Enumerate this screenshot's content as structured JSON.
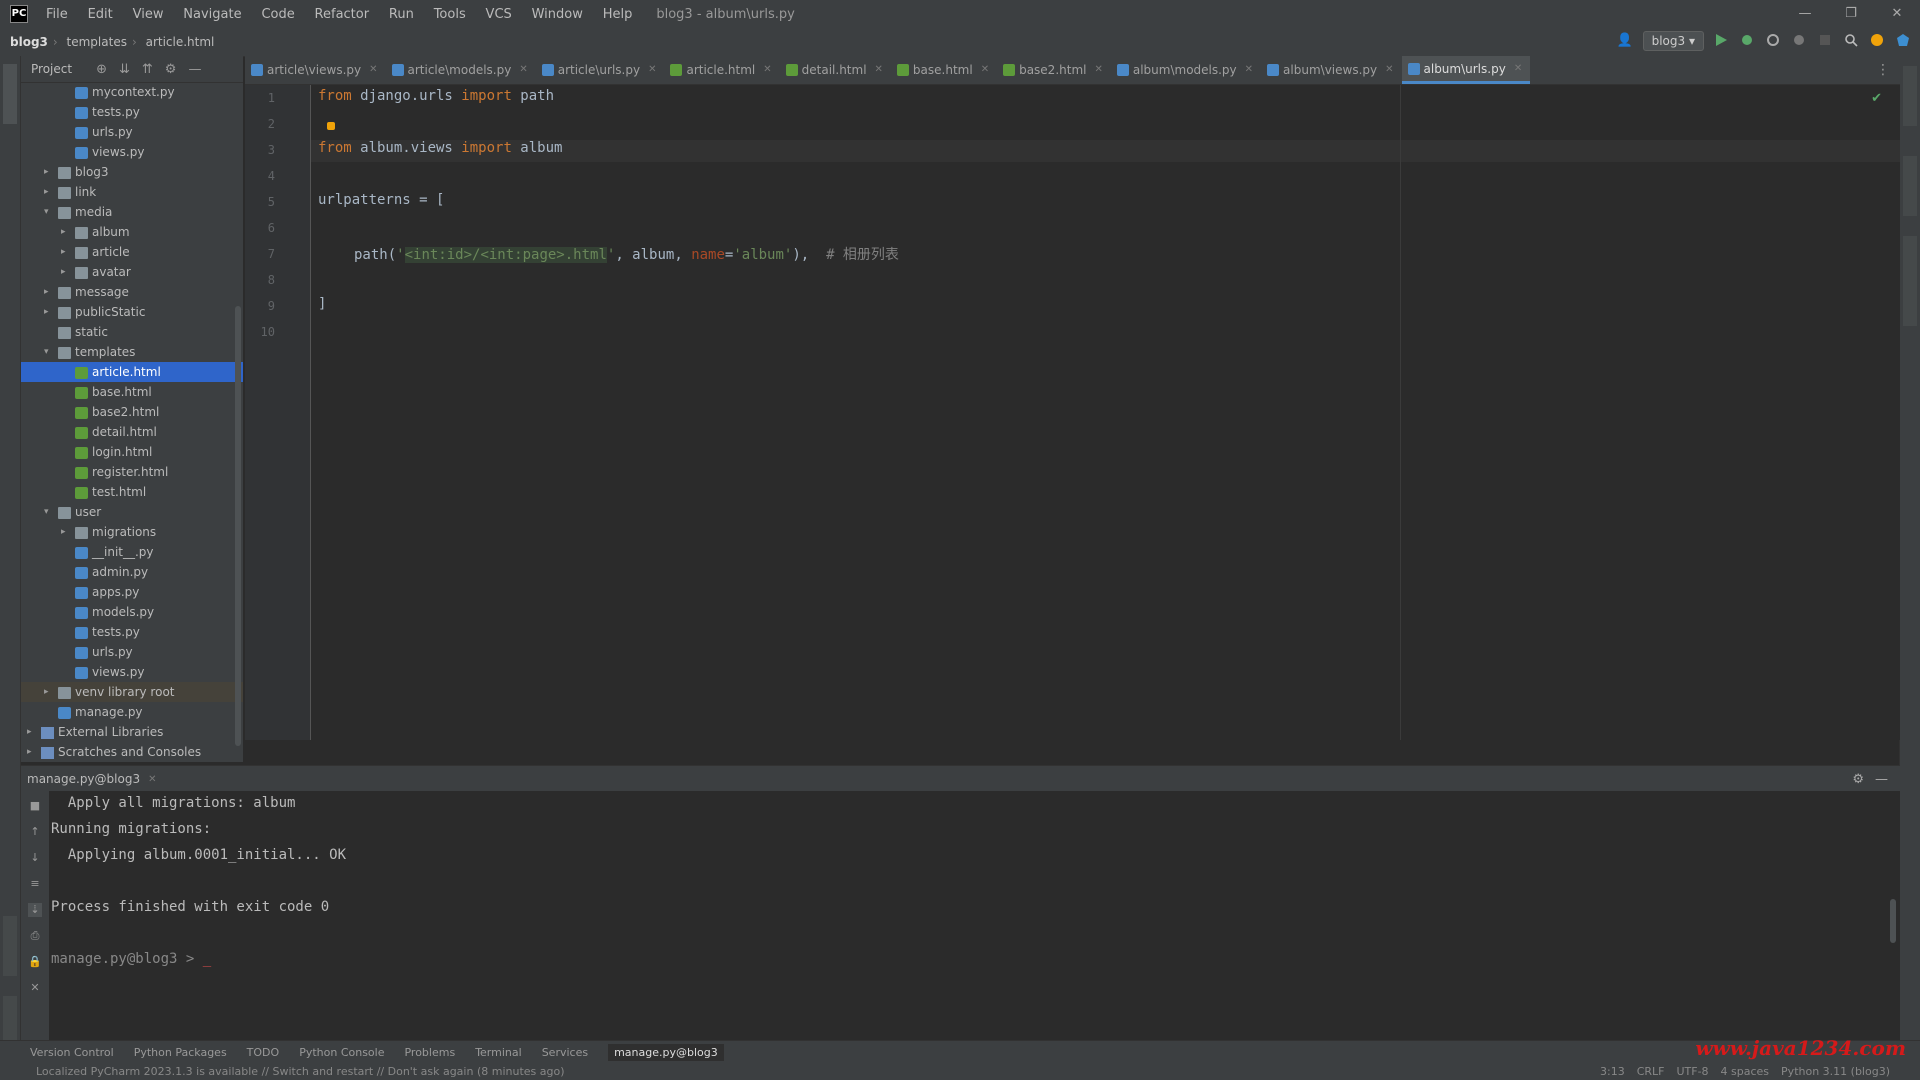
{
  "titlebar": {
    "menu": [
      "File",
      "Edit",
      "View",
      "Navigate",
      "Code",
      "Refactor",
      "Run",
      "Tools",
      "VCS",
      "Window",
      "Help"
    ],
    "title": "blog3 - album\\urls.py",
    "controls": [
      "—",
      "❐",
      "✕"
    ]
  },
  "navbar": {
    "breadcrumb": [
      "blog3",
      "templates",
      "article.html"
    ],
    "run_config": "blog3"
  },
  "project": {
    "title": "Project",
    "tree": [
      {
        "label": "mycontext.py",
        "kind": "py",
        "depth": 3
      },
      {
        "label": "tests.py",
        "kind": "py",
        "depth": 3
      },
      {
        "label": "urls.py",
        "kind": "py",
        "depth": 3
      },
      {
        "label": "views.py",
        "kind": "py",
        "depth": 3
      },
      {
        "label": "blog3",
        "kind": "folder",
        "depth": 2,
        "arrow": "›"
      },
      {
        "label": "link",
        "kind": "folder",
        "depth": 2,
        "arrow": "›"
      },
      {
        "label": "media",
        "kind": "folder",
        "depth": 2,
        "arrow": "⌄"
      },
      {
        "label": "album",
        "kind": "folder",
        "depth": 3,
        "arrow": "›"
      },
      {
        "label": "article",
        "kind": "folder",
        "depth": 3,
        "arrow": "›"
      },
      {
        "label": "avatar",
        "kind": "folder",
        "depth": 3,
        "arrow": "›"
      },
      {
        "label": "message",
        "kind": "folder",
        "depth": 2,
        "arrow": "›"
      },
      {
        "label": "publicStatic",
        "kind": "folder",
        "depth": 2,
        "arrow": "›"
      },
      {
        "label": "static",
        "kind": "folder",
        "depth": 2
      },
      {
        "label": "templates",
        "kind": "folder",
        "depth": 2,
        "arrow": "⌄"
      },
      {
        "label": "article.html",
        "kind": "html",
        "depth": 3,
        "selected": true
      },
      {
        "label": "base.html",
        "kind": "html",
        "depth": 3
      },
      {
        "label": "base2.html",
        "kind": "html",
        "depth": 3
      },
      {
        "label": "detail.html",
        "kind": "html",
        "depth": 3
      },
      {
        "label": "login.html",
        "kind": "html",
        "depth": 3
      },
      {
        "label": "register.html",
        "kind": "html",
        "depth": 3
      },
      {
        "label": "test.html",
        "kind": "html",
        "depth": 3
      },
      {
        "label": "user",
        "kind": "folder",
        "depth": 2,
        "arrow": "⌄"
      },
      {
        "label": "migrations",
        "kind": "folder",
        "depth": 3,
        "arrow": "›"
      },
      {
        "label": "__init__.py",
        "kind": "py",
        "depth": 3
      },
      {
        "label": "admin.py",
        "kind": "py",
        "depth": 3
      },
      {
        "label": "apps.py",
        "kind": "py",
        "depth": 3
      },
      {
        "label": "models.py",
        "kind": "py",
        "depth": 3
      },
      {
        "label": "tests.py",
        "kind": "py",
        "depth": 3
      },
      {
        "label": "urls.py",
        "kind": "py",
        "depth": 3
      },
      {
        "label": "views.py",
        "kind": "py",
        "depth": 3
      },
      {
        "label": "venv  library root",
        "kind": "folder",
        "depth": 2,
        "arrow": "›",
        "venv": true
      },
      {
        "label": "manage.py",
        "kind": "py",
        "depth": 2
      },
      {
        "label": "External Libraries",
        "kind": "lib",
        "depth": 1,
        "arrow": "›"
      },
      {
        "label": "Scratches and Consoles",
        "kind": "lib",
        "depth": 1,
        "arrow": "›"
      }
    ]
  },
  "tabs": [
    {
      "label": "article\\views.py"
    },
    {
      "label": "article\\models.py"
    },
    {
      "label": "article\\urls.py"
    },
    {
      "label": "article.html",
      "html": true
    },
    {
      "label": "detail.html",
      "html": true
    },
    {
      "label": "base.html",
      "html": true
    },
    {
      "label": "base2.html",
      "html": true
    },
    {
      "label": "album\\models.py"
    },
    {
      "label": "album\\views.py"
    },
    {
      "label": "album\\urls.py",
      "active": true
    }
  ],
  "editor": {
    "line_numbers": [
      "1",
      "2",
      "3",
      "4",
      "5",
      "6",
      "7",
      "8",
      "9",
      "10"
    ],
    "code": {
      "l1_kw1": "from",
      "l1_mod": " django.urls ",
      "l1_kw2": "import",
      "l1_rest": " path",
      "l3_kw1": "from",
      "l3_mod": " album.views ",
      "l3_kw2": "import",
      "l3_rest": " album",
      "l5": "urlpatterns = [",
      "l7_a": "path(",
      "l7_q1": "'",
      "l7_route": "<int:id>/<int:page>.html",
      "l7_q2": "'",
      "l7_b": ", album, ",
      "l7_name": "name",
      "l7_eq": "=",
      "l7_val": "'album'",
      "l7_c": "),  ",
      "l7_cm": "# 相册列表",
      "l9": "]"
    }
  },
  "run": {
    "title": "manage.py@blog3",
    "lines": [
      "  Apply all migrations: album",
      "Running migrations:",
      "  Applying album.0001_initial... OK",
      "",
      "Process finished with exit code 0",
      "",
      "manage.py@blog3 > "
    ]
  },
  "bottombar": [
    "Version Control",
    "Python Packages",
    "TODO",
    "Python Console",
    "Problems",
    "Terminal",
    "Services",
    "manage.py@blog3"
  ],
  "statusbar": {
    "message": "Localized PyCharm 2023.1.3 is available // Switch and restart // Don't ask again (8 minutes ago)",
    "right": [
      "3:13",
      "CRLF",
      "UTF-8",
      "4 spaces",
      "Python 3.11 (blog3)"
    ]
  },
  "watermark": "www.java1234.com",
  "colors": {
    "keyword": "#cc7832",
    "string": "#6a8759",
    "selection": "#2f65ca",
    "accent": "#4a88c7"
  }
}
